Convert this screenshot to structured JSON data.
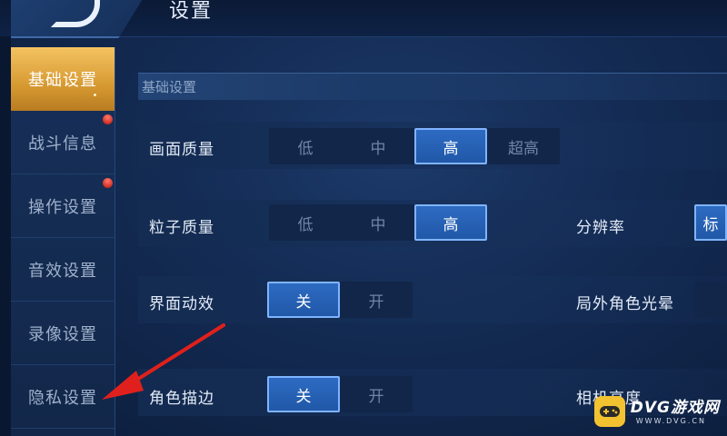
{
  "header": {
    "back_icon": "s-logo-back-icon",
    "title": "设置"
  },
  "sidebar": {
    "items": [
      {
        "label": "基础设置",
        "active": true,
        "badge": false
      },
      {
        "label": "战斗信息",
        "active": false,
        "badge": true
      },
      {
        "label": "操作设置",
        "active": false,
        "badge": true
      },
      {
        "label": "音效设置",
        "active": false,
        "badge": false
      },
      {
        "label": "录像设置",
        "active": false,
        "badge": false
      },
      {
        "label": "隐私设置",
        "active": false,
        "badge": false
      }
    ]
  },
  "main": {
    "section_title": "基础设置",
    "left_rows": [
      {
        "label": "画面质量",
        "options": [
          "低",
          "中",
          "高",
          "超高"
        ],
        "selected": "高"
      },
      {
        "label": "粒子质量",
        "options": [
          "低",
          "中",
          "高"
        ],
        "selected": "高"
      },
      {
        "label": "界面动效",
        "options": [
          "关",
          "开"
        ],
        "selected": "关"
      },
      {
        "label": "角色描边",
        "options": [
          "关",
          "开"
        ],
        "selected": "关"
      }
    ],
    "right_rows": [
      {
        "label": "分辨率",
        "partial_option": "标"
      },
      {
        "label": "局外角色光晕",
        "partial_option": ""
      },
      {
        "label": "相机高度",
        "partial_option": ""
      }
    ]
  },
  "annotation": {
    "type": "red-arrow",
    "target": "隐私设置"
  },
  "watermark": {
    "text": "DVG游戏网",
    "sub": "WWW.DVG.CN"
  },
  "colors": {
    "accent_gold": "#e0a63c",
    "selected_blue": "#2560b4",
    "badge_red": "#d8352a",
    "arrow_red": "#e0201c"
  }
}
